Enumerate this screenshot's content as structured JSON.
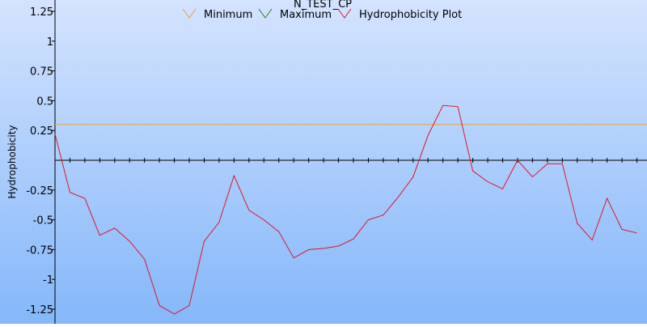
{
  "chart_data": {
    "type": "line",
    "title": "N_TEST_CP",
    "ylabel": "Hydrophobicity",
    "xlabel": "",
    "ylim": [
      -1.25,
      1.25
    ],
    "yticks": [
      {
        "value": 1.25,
        "label": "1.25"
      },
      {
        "value": 1,
        "label": "1"
      },
      {
        "value": 0.75,
        "label": "0.75"
      },
      {
        "value": 0.5,
        "label": "0.5"
      },
      {
        "value": 0.25,
        "label": "0.25"
      },
      {
        "value": -0.25,
        "label": "-0.25"
      },
      {
        "value": -0.5,
        "label": "-0.5"
      },
      {
        "value": -0.75,
        "label": "-0.75"
      },
      {
        "value": -1,
        "label": "-1"
      },
      {
        "value": -1.25,
        "label": "-1.25"
      }
    ],
    "x": [
      0,
      1,
      2,
      3,
      4,
      5,
      6,
      7,
      8,
      9,
      10,
      11,
      12,
      13,
      14,
      15,
      16,
      17,
      18,
      19,
      20,
      21,
      22,
      23,
      24,
      25,
      26,
      27,
      28,
      29,
      30,
      31,
      32,
      33,
      34,
      35,
      36,
      37,
      38,
      39,
      40
    ],
    "xlim": [
      0,
      39.7
    ],
    "legend_position": "top-center",
    "grid": false,
    "series": [
      {
        "name": "Minimum",
        "color": "#e6a23c",
        "icon": "minimum-legend-icon",
        "values": [
          0.3,
          0.3
        ],
        "x": [
          0,
          39.7
        ]
      },
      {
        "name": "Maximum",
        "color": "#1b8a1b",
        "icon": "maximum-legend-icon",
        "values": [],
        "x": []
      },
      {
        "name": "Hydrophobicity Plot",
        "color": "#e0152a",
        "icon": "hydrophobicity-legend-icon",
        "values": [
          0.22,
          -0.27,
          -0.32,
          -0.63,
          -0.57,
          -0.68,
          -0.83,
          -1.22,
          -1.29,
          -1.22,
          -0.68,
          -0.52,
          -0.13,
          -0.42,
          -0.5,
          -0.6,
          -0.82,
          -0.75,
          -0.74,
          -0.72,
          -0.66,
          -0.5,
          -0.46,
          -0.31,
          -0.14,
          0.21,
          0.46,
          0.45,
          -0.09,
          -0.18,
          -0.24,
          0.0,
          -0.14,
          -0.03,
          -0.03,
          -0.53,
          -0.67,
          -0.32,
          -0.58,
          -0.61
        ]
      }
    ]
  }
}
